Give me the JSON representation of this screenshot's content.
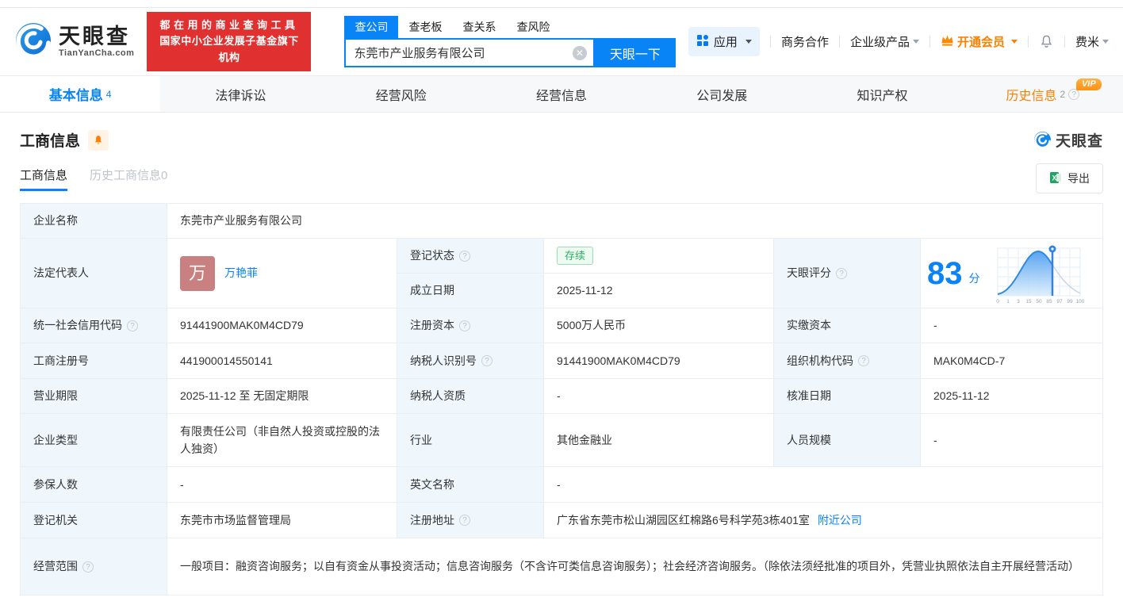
{
  "colors": {
    "primary_blue": "#0884f7",
    "brand_red": "#e03030",
    "vip_orange": "#ff8000",
    "status_green": "#2eb167",
    "label_cell_bg": "#eff7fc"
  },
  "header": {
    "logo": {
      "brand": "天眼查",
      "domain": "TianYanCha.com"
    },
    "banner": {
      "line1": "都在用的商业查询工具",
      "line2": "国家中小企业发展子基金旗下机构"
    },
    "search": {
      "tabs": [
        {
          "label": "查公司",
          "active": true
        },
        {
          "label": "查老板",
          "active": false
        },
        {
          "label": "查关系",
          "active": false
        },
        {
          "label": "查风险",
          "active": false
        }
      ],
      "value": "东莞市产业服务有限公司",
      "button": "天眼一下"
    },
    "menu": {
      "apps": "应用",
      "cooperation": "商务合作",
      "enterprise": "企业级产品",
      "membership": "开通会员",
      "user": "费米"
    }
  },
  "nav": {
    "tabs": [
      {
        "label": "基本信息",
        "count": "4",
        "active": true
      },
      {
        "label": "法律诉讼"
      },
      {
        "label": "经营风险"
      },
      {
        "label": "经营信息"
      },
      {
        "label": "公司发展"
      },
      {
        "label": "知识产权"
      },
      {
        "label": "历史信息",
        "count": "2",
        "vip": "VIP"
      }
    ]
  },
  "section": {
    "title": "工商信息",
    "watermark": "天眼查",
    "subtabs": [
      {
        "label": "工商信息",
        "active": true
      },
      {
        "label": "历史工商信息0",
        "active": false
      }
    ],
    "export_label": "导出"
  },
  "score": {
    "label": "天眼评分",
    "value": "83",
    "unit": "分",
    "axis_labels": [
      "0",
      "1",
      "3",
      "15",
      "50",
      "85",
      "97",
      "99",
      "100"
    ]
  },
  "table": {
    "company_name": {
      "label": "企业名称",
      "value": "东莞市产业服务有限公司"
    },
    "legal_rep": {
      "label": "法定代表人",
      "avatar": "万",
      "name": "万艳菲"
    },
    "reg_status": {
      "label": "登记状态",
      "value": "存续"
    },
    "establish_date": {
      "label": "成立日期",
      "value": "2025-11-12"
    },
    "credit_code": {
      "label": "统一社会信用代码",
      "value": "91441900MAK0M4CD79"
    },
    "reg_capital": {
      "label": "注册资本",
      "value": "5000万人民币"
    },
    "paid_capital": {
      "label": "实缴资本",
      "value": "-"
    },
    "reg_number": {
      "label": "工商注册号",
      "value": "441900014550141"
    },
    "taxpayer_id": {
      "label": "纳税人识别号",
      "value": "91441900MAK0M4CD79"
    },
    "org_code": {
      "label": "组织机构代码",
      "value": "MAK0M4CD-7"
    },
    "business_term": {
      "label": "营业期限",
      "value": "2025-11-12 至 无固定期限"
    },
    "taxpayer_quality": {
      "label": "纳税人资质",
      "value": "-"
    },
    "approval_date": {
      "label": "核准日期",
      "value": "2025-11-12"
    },
    "company_type": {
      "label": "企业类型",
      "value": "有限责任公司（非自然人投资或控股的法人独资）"
    },
    "industry": {
      "label": "行业",
      "value": "其他金融业"
    },
    "staff_size": {
      "label": "人员规模",
      "value": "-"
    },
    "insured_count": {
      "label": "参保人数",
      "value": "-"
    },
    "english_name": {
      "label": "英文名称",
      "value": "-"
    },
    "reg_authority": {
      "label": "登记机关",
      "value": "东莞市市场监督管理局"
    },
    "reg_address": {
      "label": "注册地址",
      "value": "广东省东莞市松山湖园区红棉路6号科学苑3栋401室",
      "link": "附近公司"
    },
    "business_scope": {
      "label": "经营范围",
      "value": "一般项目：融资咨询服务；以自有资金从事投资活动；信息咨询服务（不含许可类信息咨询服务）；社会经济咨询服务。（除依法须经批准的项目外，凭营业执照依法自主开展经营活动）"
    }
  }
}
